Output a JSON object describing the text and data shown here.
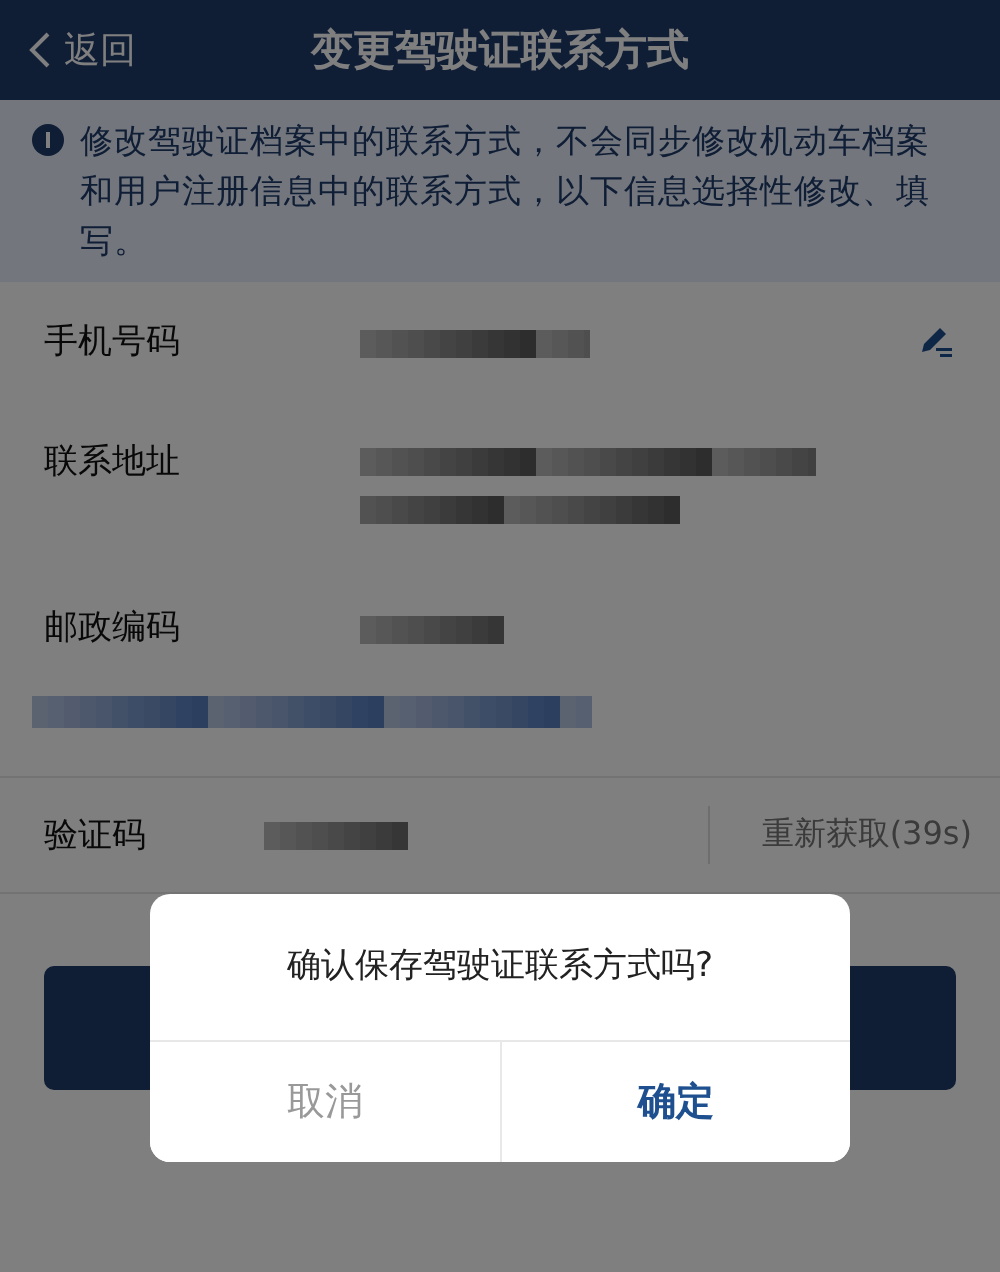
{
  "nav_bar": {
    "back_label": "返回",
    "title": "变更驾驶证联系方式"
  },
  "notice": "修改驾驶证档案中的联系方式，不会同步修改机动车档案和用户注册信息中的联系方式，以下信息选择性修改、填写。",
  "fields": [
    {
      "label": "手机号码",
      "kind": "phone",
      "editable": true
    },
    {
      "label": "联系地址",
      "kind": "address",
      "editable": false
    },
    {
      "label": "邮政编码",
      "kind": "postcode",
      "editable": false
    }
  ],
  "verification": {
    "label": "验证码",
    "resend": "重新获取(39s)"
  },
  "dialog": {
    "message": "确认保存驾驶证联系方式吗?",
    "buttons": [
      {
        "label": "取消",
        "kind": "cancel"
      },
      {
        "label": "确定",
        "kind": "confirm"
      }
    ]
  }
}
